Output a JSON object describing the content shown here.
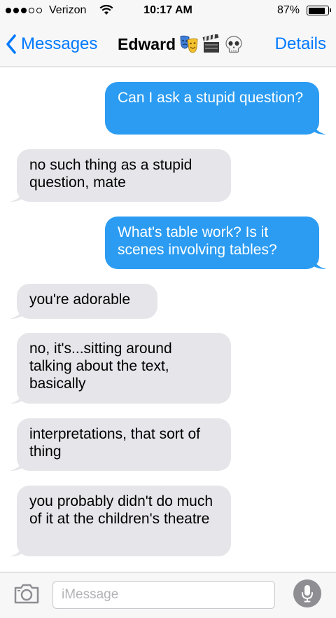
{
  "status_bar": {
    "carrier": "Verizon",
    "time": "10:17 AM",
    "battery_percent": "87%",
    "battery_level": 0.87,
    "signal_bars_filled": 3,
    "signal_bars_total": 5
  },
  "nav": {
    "back_label": "Messages",
    "contact_name": "Edward",
    "title_emoji_icons": [
      "theater-masks-icon",
      "clapper-board-icon",
      "skull-icon"
    ],
    "details_label": "Details"
  },
  "messages": [
    {
      "direction": "sent",
      "text": "Can I ask a stupid question?"
    },
    {
      "direction": "received",
      "text": "no such thing as a stupid question, mate"
    },
    {
      "direction": "sent",
      "text": "What's table work? Is it scenes involving tables?"
    },
    {
      "direction": "received",
      "text": "you're adorable"
    },
    {
      "direction": "received",
      "text": "no, it's...sitting around talking about the text, basically"
    },
    {
      "direction": "received",
      "text": "interpretations, that sort of thing"
    },
    {
      "direction": "received",
      "text": "you probably didn't do much of it at the children's theatre"
    }
  ],
  "input_bar": {
    "placeholder": "iMessage",
    "value": ""
  },
  "colors": {
    "accent": "#0079ff",
    "sent_bubble": "#2b9cf2",
    "received_bubble": "#e5e5ea",
    "bar_background": "#f7f7f8"
  }
}
